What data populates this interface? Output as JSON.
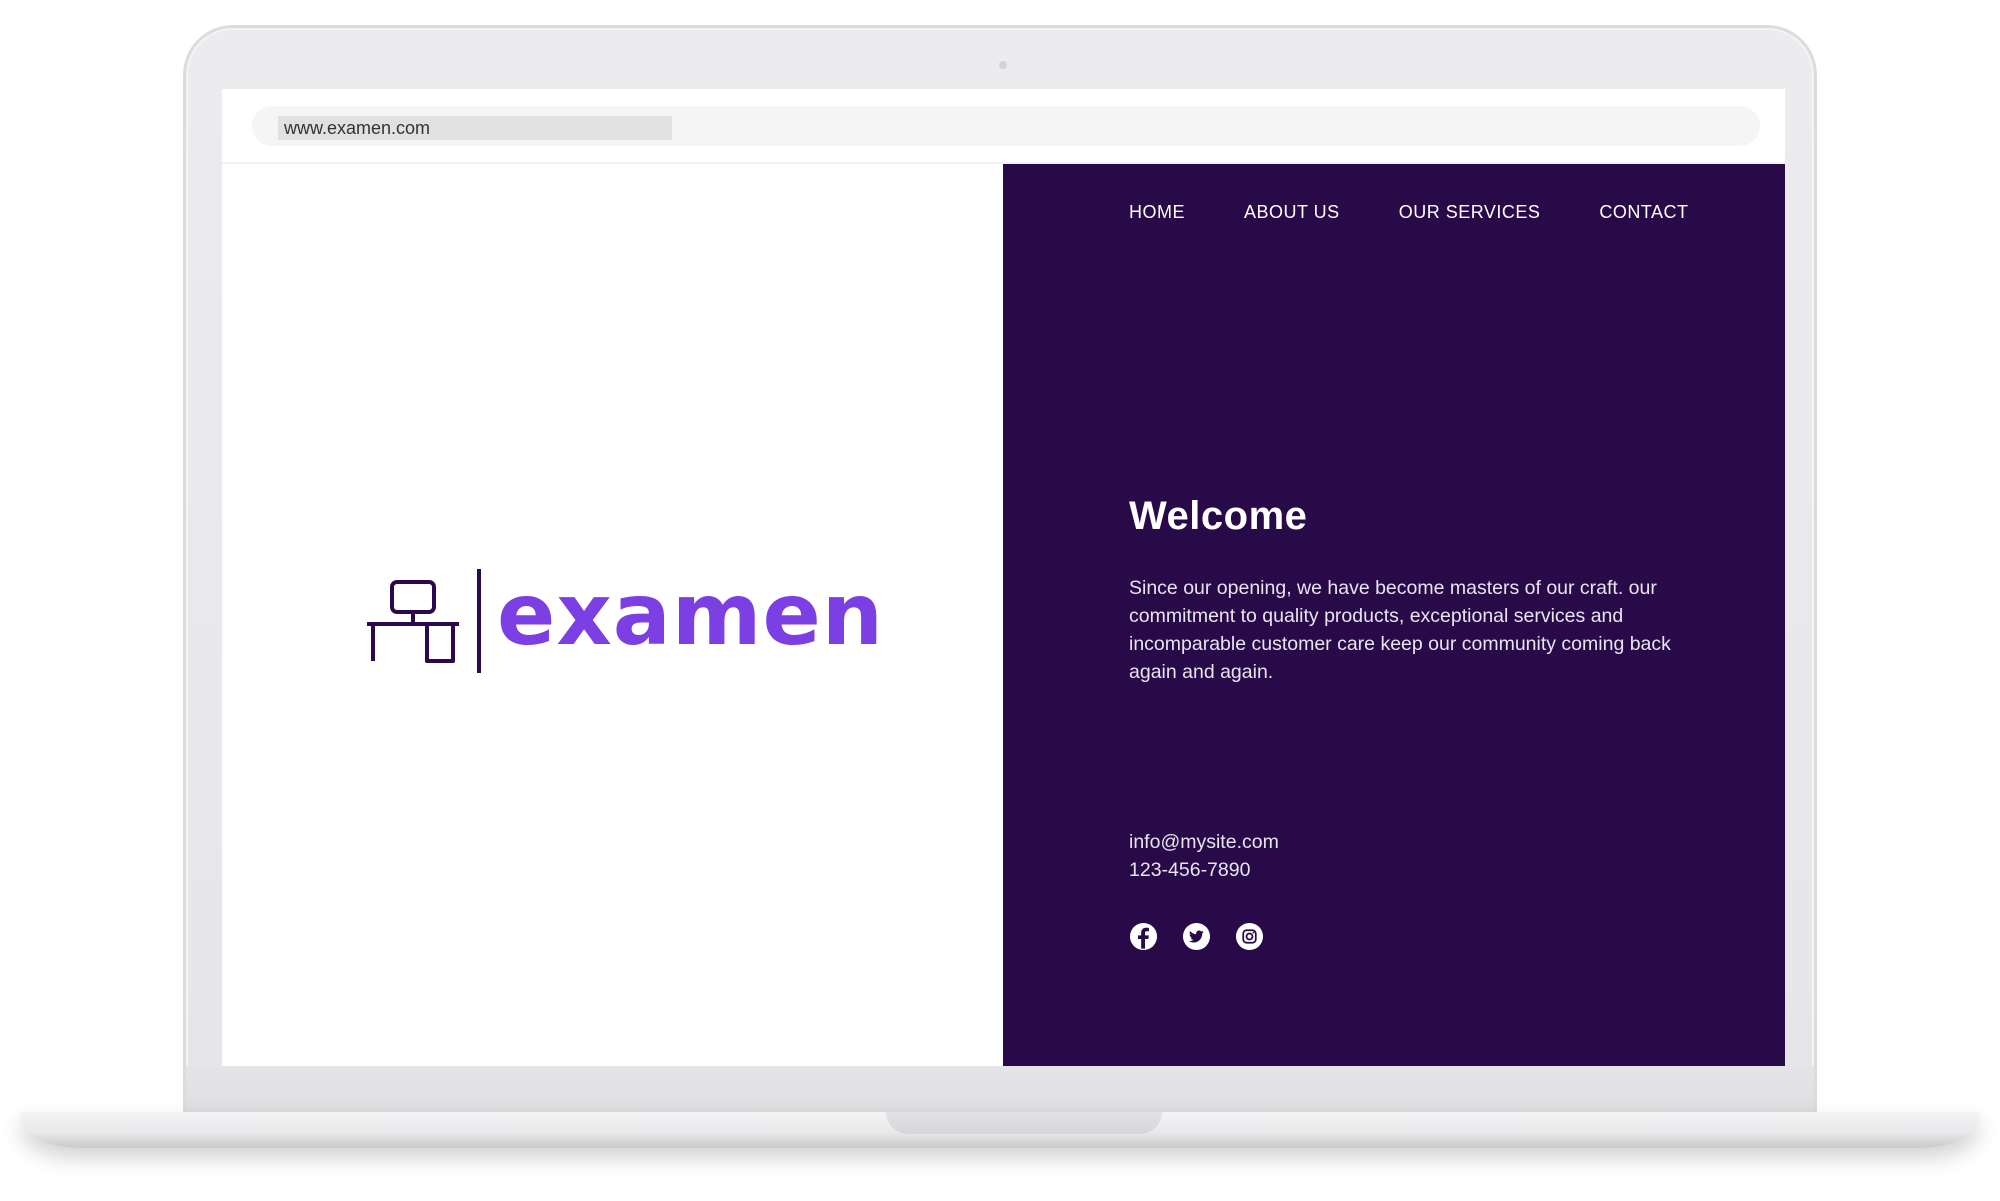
{
  "browser": {
    "url": "www.examen.com"
  },
  "logo": {
    "text": "examen",
    "icon": "desk-computer-icon"
  },
  "nav": {
    "items": [
      {
        "label": "HOME"
      },
      {
        "label": "ABOUT US"
      },
      {
        "label": "OUR SERVICES"
      },
      {
        "label": "CONTACT"
      }
    ]
  },
  "hero": {
    "heading": "Welcome",
    "body": "Since our opening, we have become masters of our craft. our commitment to quality products, exceptional services and incomparable customer care keep our community coming back again and again."
  },
  "contact": {
    "email": "info@mysite.com",
    "phone": "123-456-7890"
  },
  "social": {
    "icons": [
      "facebook-icon",
      "twitter-icon",
      "instagram-icon"
    ]
  },
  "colors": {
    "panel_background": "#290a49",
    "logo_text": "#7b3fe4",
    "logo_mark": "#2a0a4a",
    "text_on_panel": "#ffffff"
  }
}
